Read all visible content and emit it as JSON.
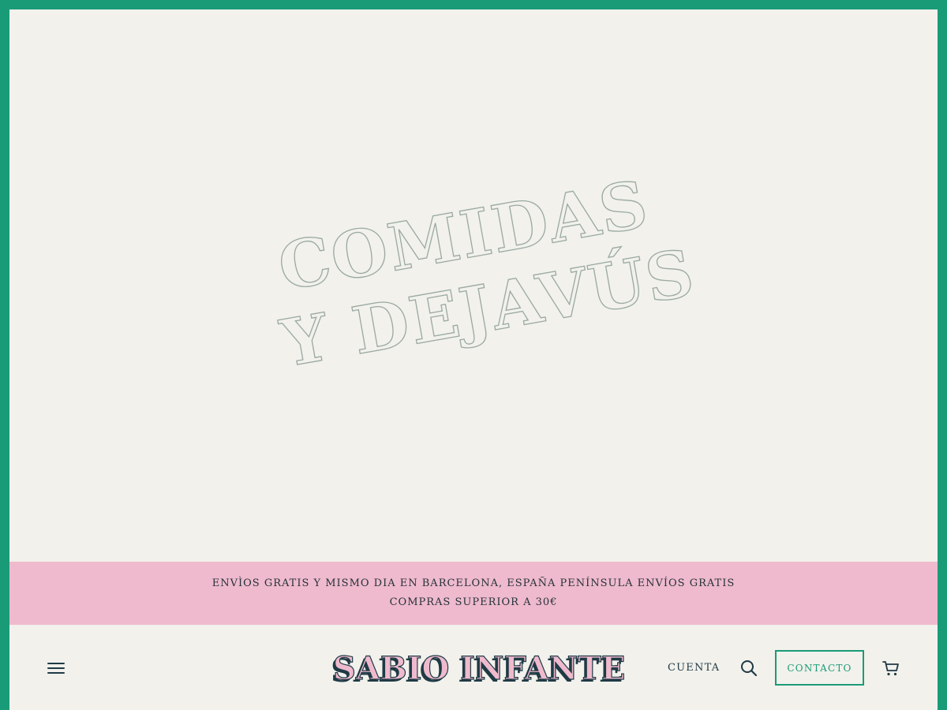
{
  "hero": {
    "line1": "COMIDAS",
    "line2": "Y DEJAVÚS"
  },
  "announcement": {
    "text": "ENVÌOS GRATIS Y MISMO DIA EN BARCELONA, ESPAÑA PENÍNSULA ENVÍOS GRATIS COMPRAS SUPERIOR A 30€"
  },
  "header": {
    "logo": "SABIO INFANTE",
    "account_label": "CUENTA",
    "contact_label": "CONTACTO",
    "icons": {
      "menu": "menu-icon",
      "search": "search-icon",
      "cart": "cart-icon"
    }
  },
  "colors": {
    "frame": "#1a9b78",
    "background": "#f2f1ec",
    "banner": "#efbacd",
    "text_dark": "#1f3a45",
    "accent_green": "#1a9b78",
    "logo_pink": "#efbacd"
  }
}
